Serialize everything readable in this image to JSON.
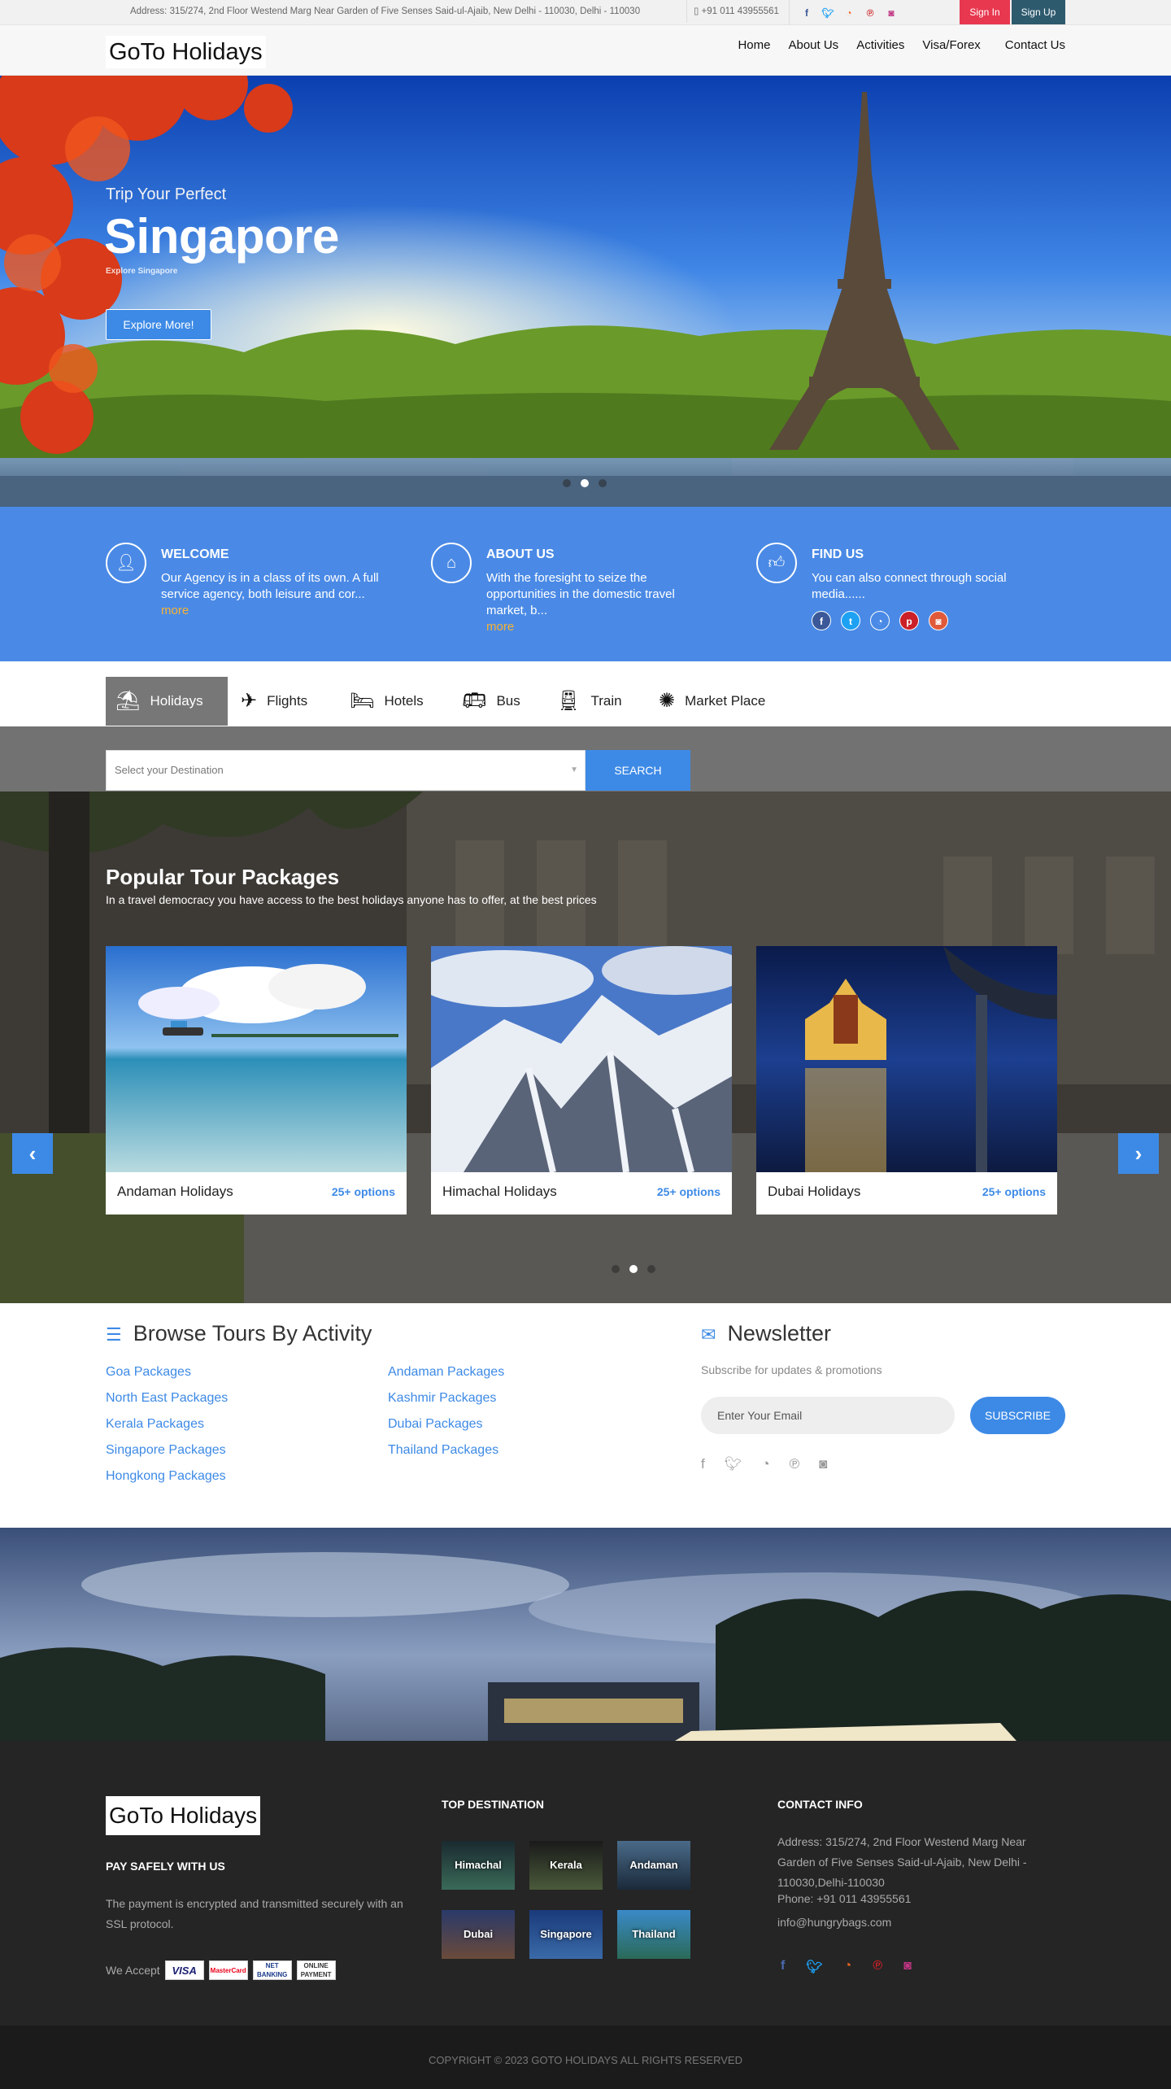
{
  "topbar": {
    "address": "Address: 315/274, 2nd Floor Westend Marg Near Garden of Five Senses Said-ul-Ajaib, New Delhi - 110030, Delhi - 110030",
    "phone": "+91 011 43955561",
    "socials": [
      "facebook-icon",
      "twitter-icon",
      "rss-icon",
      "pinterest-icon",
      "instagram-icon"
    ],
    "signin": "Sign In",
    "signup": "Sign Up"
  },
  "brand": {
    "logo": "GoTo Holidays"
  },
  "nav": {
    "items": [
      "Home",
      "About Us",
      "Activities",
      "Visa/Forex",
      "Contact Us"
    ]
  },
  "hero": {
    "subtitle": "Trip Your Perfect",
    "title": "Singapore",
    "tagline": "Explore Singapore",
    "button": "Explore More!",
    "slides_total": 3,
    "slides_active": 2
  },
  "info": [
    {
      "icon": "user-icon",
      "title": "WELCOME",
      "text": "Our Agency is in a class of its own. A full service agency, both leisure and cor...",
      "more": "more"
    },
    {
      "icon": "home-icon",
      "title": "ABOUT US",
      "text": "With the foresight to seize the opportunities in the domestic travel market, b...",
      "more": "more"
    },
    {
      "icon": "thumbs-up-icon",
      "title": "FIND US",
      "text": "You can also connect through social media......",
      "socials": [
        "facebook-icon",
        "twitter-icon",
        "rss-icon",
        "pinterest-icon",
        "instagram-icon"
      ]
    }
  ],
  "tabs": [
    {
      "icon": "beach-umbrella-icon",
      "label": "Holidays",
      "active": true
    },
    {
      "icon": "plane-icon",
      "label": "Flights"
    },
    {
      "icon": "bed-icon",
      "label": "Hotels"
    },
    {
      "icon": "bus-icon",
      "label": "Bus"
    },
    {
      "icon": "train-icon",
      "label": "Train"
    },
    {
      "icon": "gear-icon",
      "label": "Market Place"
    }
  ],
  "search": {
    "placeholder": "Select your Destination",
    "button": "SEARCH"
  },
  "packages": {
    "title": "Popular Tour Packages",
    "subtitle": "In a travel democracy you have access to the best holidays anyone has to offer, at the best prices",
    "cards": [
      {
        "name": "Andaman Holidays",
        "options": "25+ options"
      },
      {
        "name": "Himachal Holidays",
        "options": "25+ options"
      },
      {
        "name": "Dubai Holidays",
        "options": "25+ options"
      }
    ]
  },
  "browse": {
    "title": "Browse Tours By Activity",
    "col1": [
      "Goa Packages",
      "North East Packages",
      "Kerala Packages",
      "Singapore Packages",
      "Hongkong Packages"
    ],
    "col2": [
      "Andaman Packages",
      "Kashmir Packages",
      "Dubai Packages",
      "Thailand Packages"
    ]
  },
  "newsletter": {
    "title": "Newsletter",
    "subtitle": "Subscribe for updates & promotions",
    "placeholder": "Enter Your Email",
    "button": "SUBSCRIBE"
  },
  "footer": {
    "logo": "GoTo Holidays",
    "pay_title": "PAY SAFELY WITH US",
    "pay_text": "The payment is encrypted and transmitted securely with an SSL protocol.",
    "we_accept": "We Accept",
    "cards": [
      "VISA",
      "MasterCard",
      "NET BANKING",
      "ONLINE PAYMENT"
    ],
    "dest_title": "TOP DESTINATION",
    "destinations": [
      "Himachal",
      "Kerala",
      "Andaman",
      "Dubai",
      "Singapore",
      "Thailand"
    ],
    "contact_title": "CONTACT INFO",
    "contact_address": "Address: 315/274, 2nd Floor Westend Marg Near Garden of Five Senses Said-ul-Ajaib, New Delhi - 110030,Delhi-110030",
    "contact_phone": "Phone: +91 011 43955561",
    "contact_email": "info@hungrybags.com",
    "copyright": "COPYRIGHT © 2023 GOTO HOLIDAYS ALL RIGHTS RESERVED"
  },
  "colors": {
    "accent": "#3d8ae6",
    "signin": "#e8384f",
    "signup": "#2e5a6e",
    "info_band": "#4a8ae6",
    "footer": "#252525",
    "more": "#f7b232"
  }
}
